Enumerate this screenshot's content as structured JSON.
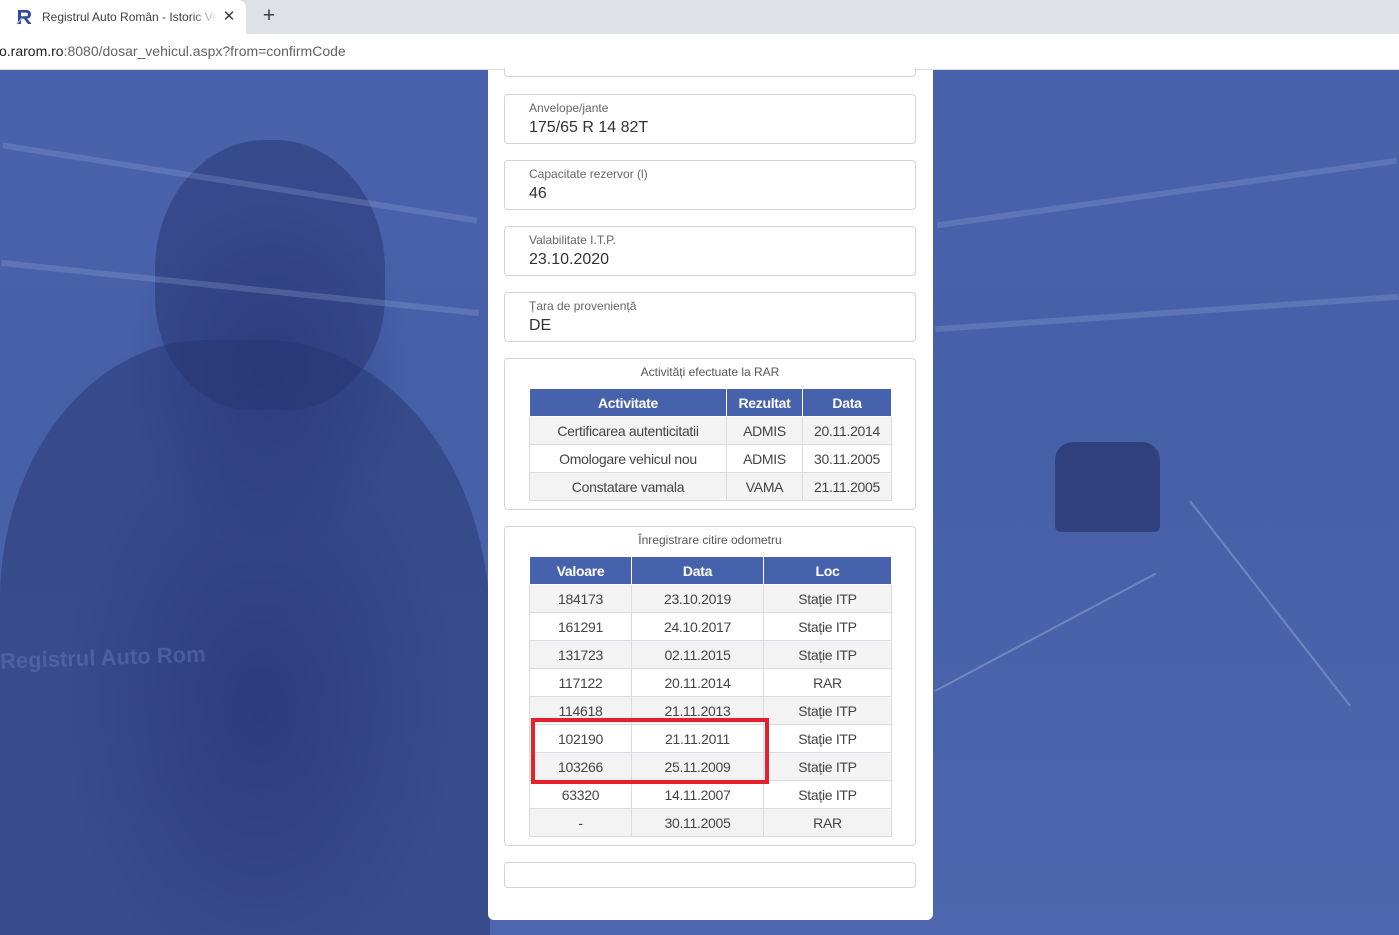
{
  "browser": {
    "tab_title": "Registrul Auto Român - Istoric Vehicul",
    "close_glyph": "✕",
    "new_tab_glyph": "+",
    "url_host": "o.rarom.ro",
    "url_rest": ":8080/dosar_vehicul.aspx?from=confirmCode"
  },
  "background": {
    "watermark": "Registrul Auto Rom"
  },
  "fields": [
    {
      "label": "Anvelope/jante",
      "value": "175/65 R 14 82T"
    },
    {
      "label": "Capacitate rezervor (l)",
      "value": "46"
    },
    {
      "label": "Valabilitate I.T.P.",
      "value": "23.10.2020"
    },
    {
      "label": "Țara de proveniență",
      "value": "DE"
    }
  ],
  "activities": {
    "title": "Activități efectuate la RAR",
    "headers": [
      "Activitate",
      "Rezultat",
      "Data"
    ],
    "rows": [
      [
        "Certificarea autenticitatii",
        "ADMIS",
        "20.11.2014"
      ],
      [
        "Omologare vehicul nou",
        "ADMIS",
        "30.11.2005"
      ],
      [
        "Constatare vamala",
        "VAMA",
        "21.11.2005"
      ]
    ]
  },
  "odometer": {
    "title": "Înregistrare citire odometru",
    "headers": [
      "Valoare",
      "Data",
      "Loc"
    ],
    "rows": [
      [
        "184173",
        "23.10.2019",
        "Stație ITP"
      ],
      [
        "161291",
        "24.10.2017",
        "Stație ITP"
      ],
      [
        "131723",
        "02.11.2015",
        "Stație ITP"
      ],
      [
        "117122",
        "20.11.2014",
        "RAR"
      ],
      [
        "114618",
        "21.11.2013",
        "Stație ITP"
      ],
      [
        "102190",
        "21.11.2011",
        "Stație ITP"
      ],
      [
        "103266",
        "25.11.2009",
        "Stație ITP"
      ],
      [
        "63320",
        "14.11.2007",
        "Stație ITP"
      ],
      [
        "-",
        "30.11.2005",
        "RAR"
      ]
    ]
  },
  "colors": {
    "page_background": "#4a62ab",
    "table_header": "#4762ad",
    "highlight": "#e5202b"
  }
}
